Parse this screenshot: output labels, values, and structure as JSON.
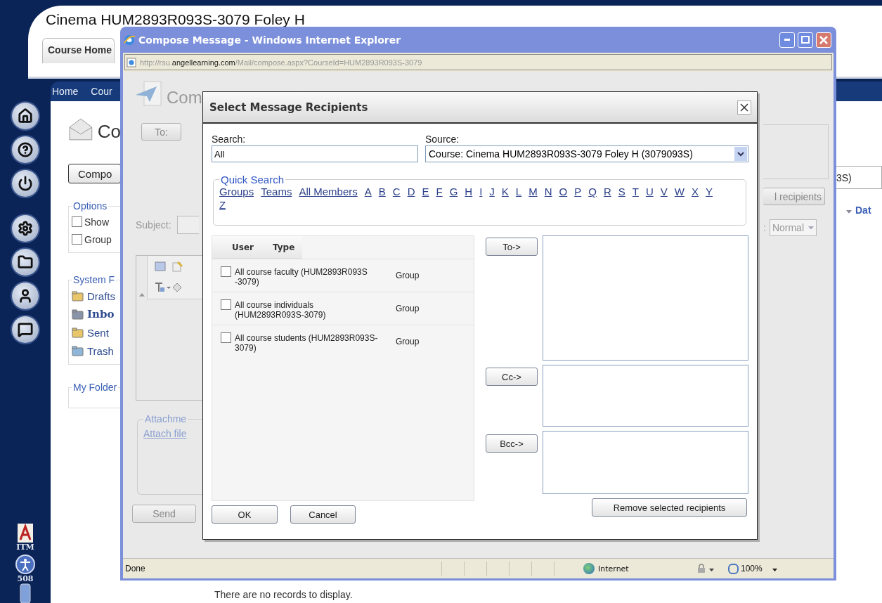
{
  "course_page": {
    "title": "Cinema HUM2893R093S-3079 Foley H",
    "tabs": [
      {
        "label": "Course Home",
        "selected": true
      }
    ],
    "breadcrumb": [
      "Home",
      "Cour"
    ],
    "tools": [
      {
        "label": "ITM"
      },
      {
        "label": "508"
      }
    ],
    "heading": "Co",
    "compose_button": "Compo",
    "options": {
      "legend": "Options",
      "items": [
        {
          "label": "Show",
          "checked": false
        },
        {
          "label": "Group",
          "checked": false
        }
      ]
    },
    "system_folders": {
      "legend": "System F",
      "items": [
        {
          "label": "Drafts",
          "kind": "drafts",
          "selected": false
        },
        {
          "label": "Inbo",
          "kind": "inbox",
          "selected": true
        },
        {
          "label": "Sent",
          "kind": "sent",
          "selected": false
        },
        {
          "label": "Trash",
          "kind": "trash",
          "selected": false
        }
      ]
    },
    "my_folders": {
      "legend": "My Folder"
    },
    "source_fragment": "3S)",
    "column_header": "Dat",
    "empty_message": "There are no records to display."
  },
  "browser": {
    "title": "Compose Message - Windows Internet Explorer",
    "address": "http://rsu.**angellearning.com**/Mail/compose.aspx?CourseId=HUM2893R093S-3079",
    "status": "Done",
    "zone": "Internet",
    "zoom": "100%"
  },
  "compose": {
    "heading": "Com",
    "to_button": "To:",
    "subject_label": "Subject:",
    "attachments_legend": "Attachme",
    "attach_link": "Attach file",
    "send_button": "Send",
    "recipients_button": "l recipients",
    "priority_label": ":",
    "priority": "Normal"
  },
  "dialog": {
    "title": "Select Message Recipients",
    "search": {
      "label": "Search:",
      "value": "All"
    },
    "source": {
      "label": "Source:",
      "value": "Course: Cinema HUM2893R093S-3079 Foley H (3079093S)"
    },
    "quick_search": {
      "legend": "Quick Search",
      "links": [
        "Groups",
        "Teams",
        "All Members",
        "A",
        "B",
        "C",
        "D",
        "E",
        "F",
        "G",
        "H",
        "I",
        "J",
        "K",
        "L",
        "M",
        "N",
        "O",
        "P",
        "Q",
        "R",
        "S",
        "T",
        "U",
        "V",
        "W",
        "X",
        "Y",
        "Z"
      ]
    },
    "table": {
      "columns": [
        "User",
        "Type"
      ],
      "rows": [
        {
          "user": "All course faculty (HUM2893R093S -3079)",
          "type": "Group",
          "checked": false
        },
        {
          "user": "All course individuals (HUM2893R093S-3079)",
          "type": "Group",
          "checked": false
        },
        {
          "user": "All course students (HUM2893R093S-3079)",
          "type": "Group",
          "checked": false
        }
      ]
    },
    "recipients": [
      {
        "button": "To->"
      },
      {
        "button": "Cc->"
      },
      {
        "button": "Bcc->"
      }
    ],
    "remove_button": "Remove selected recipients",
    "buttons": [
      "OK",
      "Cancel"
    ]
  }
}
